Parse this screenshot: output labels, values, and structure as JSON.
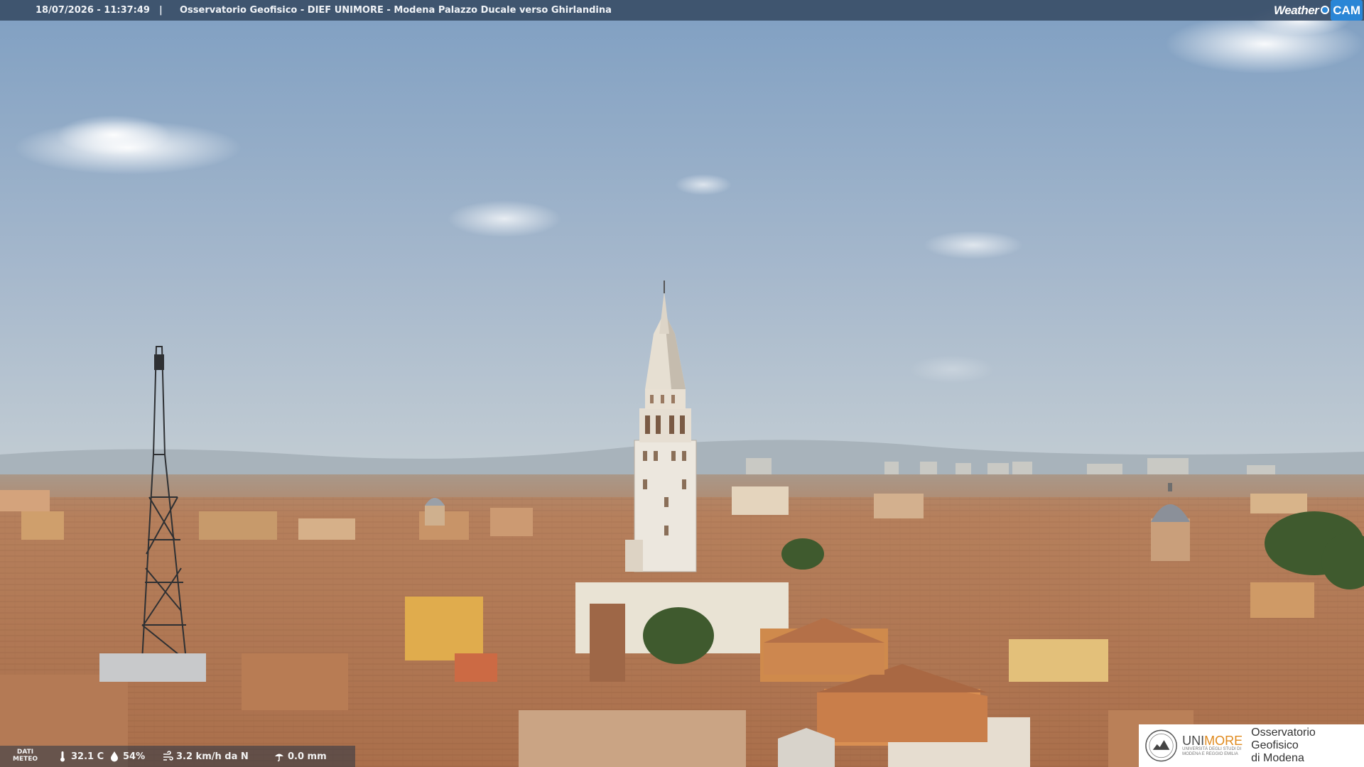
{
  "header": {
    "timestamp": "18/07/2026 - 11:37:49",
    "separator": "|",
    "title": "Osservatorio Geofisico - DIEF UNIMORE - Modena Palazzo Ducale verso Ghirlandina",
    "brand_weather": "Weather",
    "brand_cam": "CAM"
  },
  "meteo": {
    "label_line1": "DATI",
    "label_line2": "METEO",
    "temperature": "32.1 C",
    "humidity": "54%",
    "wind": "3.2 km/h da N",
    "rain": "0.0 mm"
  },
  "logo": {
    "uni_prefix": "UNI",
    "uni_suffix": "MORE",
    "uni_sub_line1": "UNIVERSITÀ DEGLI STUDI DI",
    "uni_sub_line2": "MODENA E REGGIO EMILIA",
    "observatory_line1": "Osservatorio Geofisico",
    "observatory_line2": "di Modena"
  },
  "icons": {
    "temperature": "thermometer-icon",
    "humidity": "droplet-icon",
    "wind": "wind-icon",
    "rain": "rain-gauge-icon"
  },
  "colors": {
    "topbar": "#3a4e68",
    "sky_top": "#7f9fc2",
    "sky_horizon": "#c3cdd3",
    "roofs": "#b9805a",
    "tower": "#ece7de",
    "unimore_orange": "#e08a1e"
  }
}
